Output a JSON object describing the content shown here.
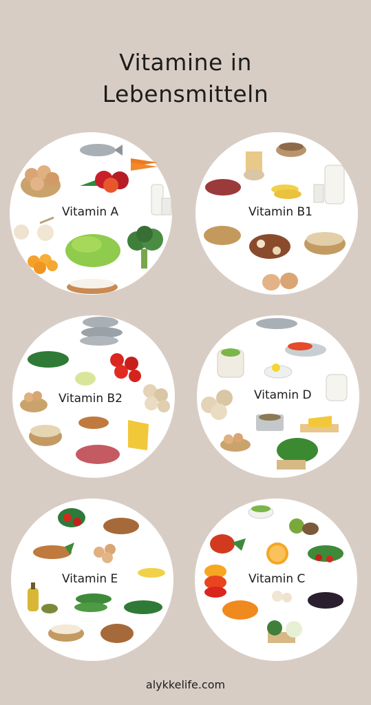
{
  "title": {
    "line1": "Vitamine in",
    "line2": "Lebensmitteln"
  },
  "vitamins": [
    {
      "label": "Vitamin A"
    },
    {
      "label": "Vitamin B1"
    },
    {
      "label": "Vitamin B2"
    },
    {
      "label": "Vitamin D"
    },
    {
      "label": "Vitamin E"
    },
    {
      "label": "Vitamin C"
    }
  ],
  "footer": "alykkelife.com",
  "colors": {
    "background": "#d8cdc4",
    "circle": "#ffffff",
    "text": "#1c1c1c"
  }
}
